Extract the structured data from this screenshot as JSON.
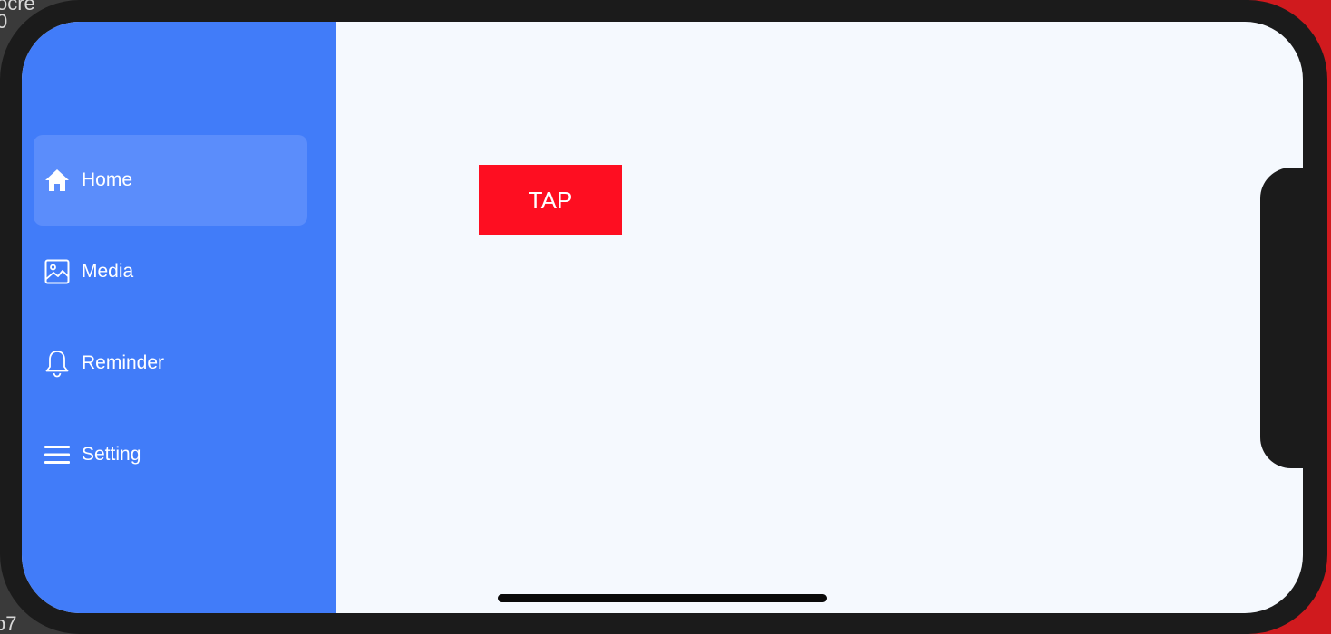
{
  "backdrop": {
    "top_left_text": "ocre\n0",
    "bottom_left_text": "b7"
  },
  "sidebar": {
    "items": [
      {
        "label": "Home",
        "icon": "home-icon",
        "active": true
      },
      {
        "label": "Media",
        "icon": "image-icon",
        "active": false
      },
      {
        "label": "Reminder",
        "icon": "bell-icon",
        "active": false
      },
      {
        "label": "Setting",
        "icon": "menu-icon",
        "active": false
      }
    ]
  },
  "main": {
    "tap_button_label": "TAP"
  },
  "colors": {
    "sidebar_bg": "#417cf9",
    "sidebar_active_bg": "#5b8dfb",
    "content_bg": "#f5f9fe",
    "tap_button_bg": "#fe0e21",
    "device_frame": "#1b1b1b"
  }
}
